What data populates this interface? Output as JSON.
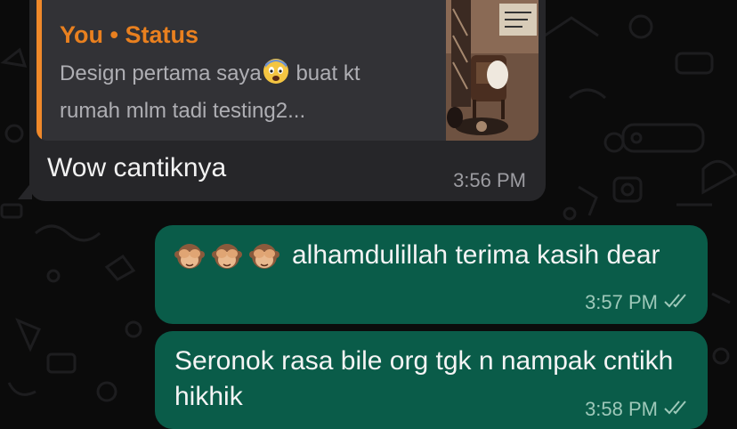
{
  "incoming_message": {
    "quote": {
      "author": "You • Status",
      "text_part1": "Design pertama saya",
      "text_emoji": "fearful-face-icon",
      "text_part2": "buat kt rumah mlm tadi testing2..."
    },
    "text": "Wow cantiknya",
    "time": "3:56 PM"
  },
  "outgoing_messages": [
    {
      "emojis": [
        "see-no-evil-monkey-icon",
        "see-no-evil-monkey-icon",
        "see-no-evil-monkey-icon"
      ],
      "text": "alhamdulillah terima kasih dear",
      "time": "3:57 PM",
      "status_icon": "double-check-icon"
    },
    {
      "text": "Seronok rasa bile org tgk n nampak cntikh hikhik",
      "time": "3:58 PM",
      "status_icon": "double-check-icon"
    }
  ],
  "colors": {
    "background": "#0b0b0b",
    "incoming_bubble": "#262629",
    "quote_accent": "#e9801f",
    "outgoing_bubble": "#0a5c49"
  }
}
